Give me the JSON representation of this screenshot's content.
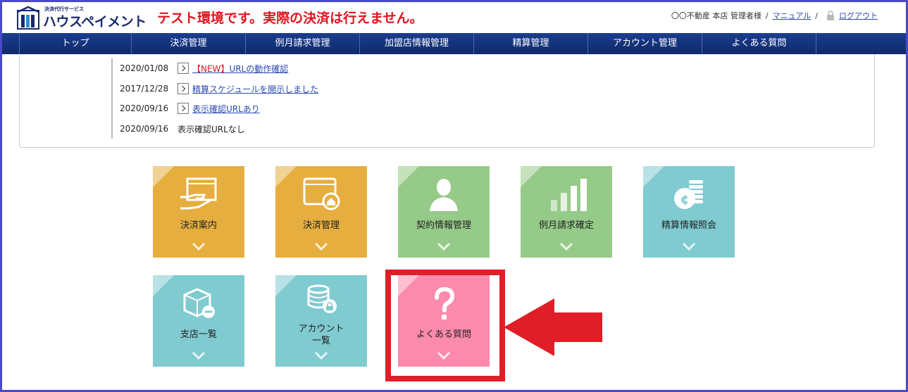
{
  "header": {
    "logo_sub": "決済代行サービス",
    "logo_text": "ハウスペイメント",
    "warning": "テスト環境です。実際の決済は行えません。",
    "user_name": "〇〇不動産 本店 管理者様",
    "sep": "/",
    "manual_label": "マニュアル",
    "logout_label": "ログアウト"
  },
  "nav": {
    "items": [
      "トップ",
      "決済管理",
      "例月請求管理",
      "加盟店情報管理",
      "精算管理",
      "アカウント管理",
      "よくある質問"
    ]
  },
  "news": {
    "items": [
      {
        "date": "2020/01/08",
        "tag": "【NEW】",
        "text": "URLの動作確認"
      },
      {
        "date": "2017/12/28",
        "tag": "",
        "text": "精算スケジュールを開示しました"
      },
      {
        "date": "2020/09/16",
        "tag": "",
        "text": "表示確認URLあり"
      },
      {
        "date": "2020/09/16",
        "tag": "",
        "text": "表示確認URLなし"
      }
    ]
  },
  "tiles": [
    {
      "label": "決済案内",
      "color": "#e5ae3f",
      "icon": "payment-hand-icon"
    },
    {
      "label": "決済管理",
      "color": "#e5ae3f",
      "icon": "browser-home-icon"
    },
    {
      "label": "契約情報管理",
      "color": "#96ca88",
      "icon": "person-icon"
    },
    {
      "label": "例月請求確定",
      "color": "#96ca88",
      "icon": "bar-chart-icon"
    },
    {
      "label": "精算情報照会",
      "color": "#7fcbd0",
      "icon": "coin-stack-icon"
    },
    {
      "label": "支店一覧",
      "color": "#7fcbd0",
      "icon": "box-minus-icon"
    },
    {
      "label": "アカウント\n一覧",
      "color": "#7fcbd0",
      "icon": "database-lock-icon"
    },
    {
      "label": "よくある質問",
      "color": "#fc8aad",
      "icon": "question-icon"
    }
  ],
  "annotation": {
    "highlight_color": "#e01e27"
  }
}
